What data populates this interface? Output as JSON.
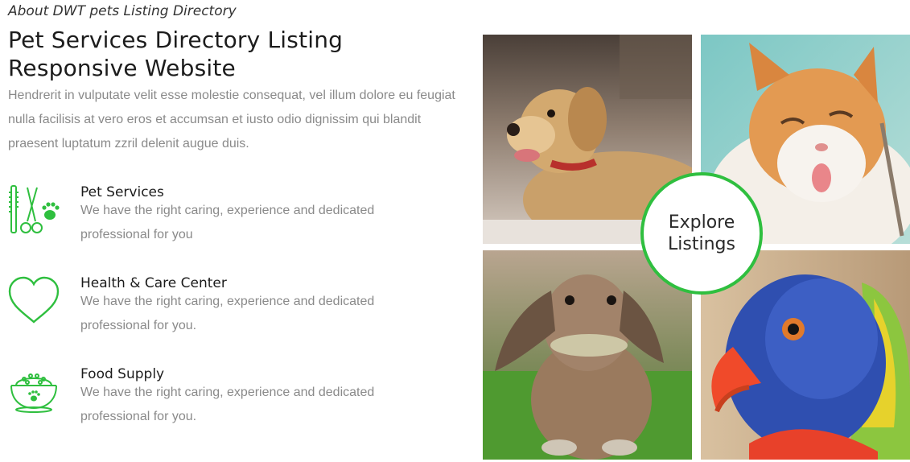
{
  "about": {
    "eyebrow": "About DWT pets Listing Directory",
    "title": "Pet Services Directory Listing Responsive Website",
    "intro": "Hendrerit in vulputate velit esse molestie consequat, vel illum dolore eu feugiat nulla facilisis at vero eros et accumsan et iusto odio dignissim qui blandit praesent luptatum zzril delenit augue duis."
  },
  "features": [
    {
      "icon": "grooming-icon",
      "title": "Pet Services",
      "description": "We have the right caring, experience and dedicated professional for you"
    },
    {
      "icon": "heart-icon",
      "title": "Health & Care Center",
      "description": "We have the right caring, experience and dedicated professional for you."
    },
    {
      "icon": "food-bowl-icon",
      "title": "Food Supply",
      "description": "We have the right caring, experience and dedicated professional for you."
    }
  ],
  "gallery": {
    "photos": [
      "puppy-photo",
      "cat-photo",
      "rabbit-photo",
      "parrot-photo"
    ],
    "explore_line1": "Explore",
    "explore_line2": "Listings"
  },
  "colors": {
    "accent": "#2fbf3f",
    "heading": "#1c1c1c",
    "muted": "#8a8a8a"
  }
}
